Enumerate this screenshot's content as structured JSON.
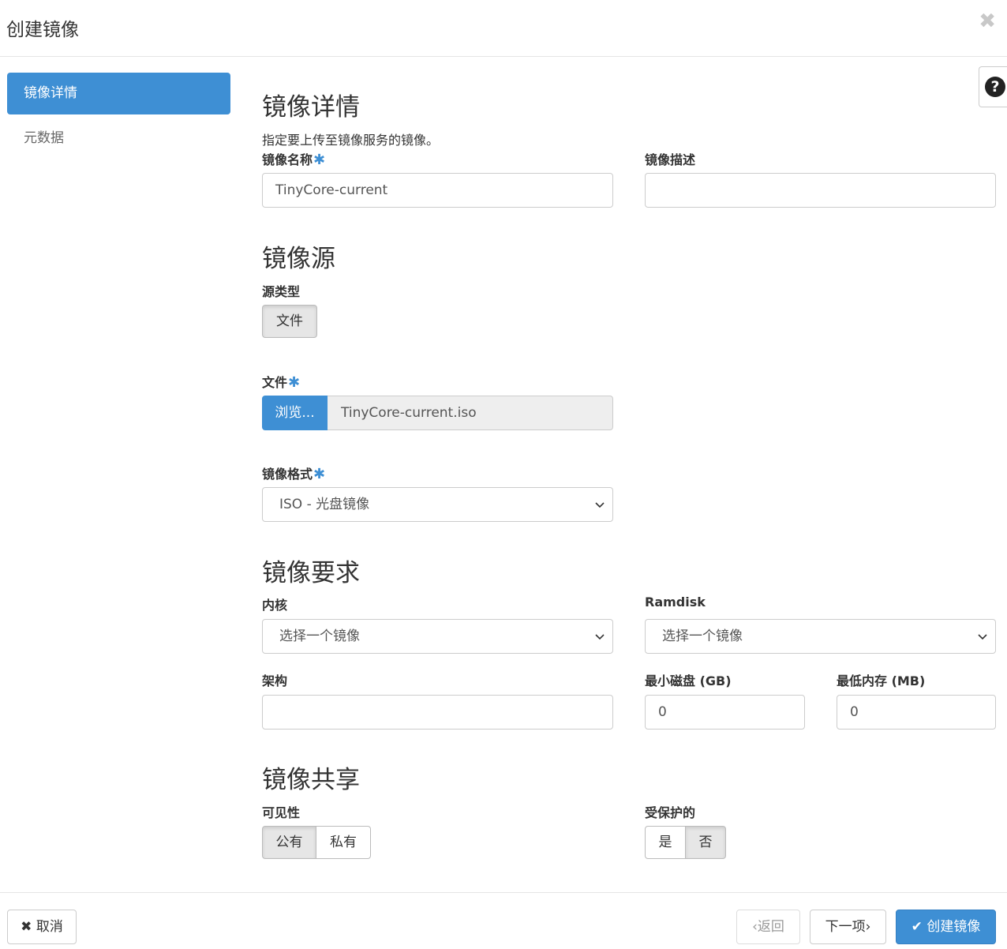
{
  "modal": {
    "title": "创建镜像",
    "close_symbol": "✖"
  },
  "sidebar": {
    "items": [
      {
        "label": "镜像详情",
        "active": true
      },
      {
        "label": "元数据",
        "active": false
      }
    ]
  },
  "help": {
    "symbol": "?"
  },
  "details": {
    "heading": "镜像详情",
    "description": "指定要上传至镜像服务的镜像。",
    "name": {
      "label": "镜像名称",
      "value": "TinyCore-current"
    },
    "desc_field": {
      "label": "镜像描述",
      "value": ""
    }
  },
  "source": {
    "heading": "镜像源",
    "type_label": "源类型",
    "type_button": "文件",
    "file_label": "文件",
    "browse_label": "浏览...",
    "file_name": "TinyCore-current.iso",
    "format_label": "镜像格式",
    "format_value": "ISO - 光盘镜像"
  },
  "requirements": {
    "heading": "镜像要求",
    "kernel": {
      "label": "内核",
      "value": "选择一个镜像"
    },
    "ramdisk": {
      "label": "Ramdisk",
      "value": "选择一个镜像"
    },
    "arch": {
      "label": "架构",
      "value": ""
    },
    "min_disk": {
      "label": "最小磁盘 (GB)",
      "value": "0"
    },
    "min_ram": {
      "label": "最低内存 (MB)",
      "value": "0"
    }
  },
  "sharing": {
    "heading": "镜像共享",
    "visibility_label": "可见性",
    "visibility_options": [
      "公有",
      "私有"
    ],
    "visibility_selected": "公有",
    "protected_label": "受保护的",
    "protected_options": [
      "是",
      "否"
    ],
    "protected_selected": "否"
  },
  "footer": {
    "cancel": "取消",
    "back": "返回",
    "next": "下一项",
    "create": "创建镜像"
  },
  "colors": {
    "primary": "#3e8fd4",
    "required": "#3e8fd4"
  },
  "icons": [
    "close-icon",
    "help-icon",
    "chevron-down-icon",
    "x-icon",
    "chevron-left-icon",
    "chevron-right-icon",
    "check-icon"
  ]
}
